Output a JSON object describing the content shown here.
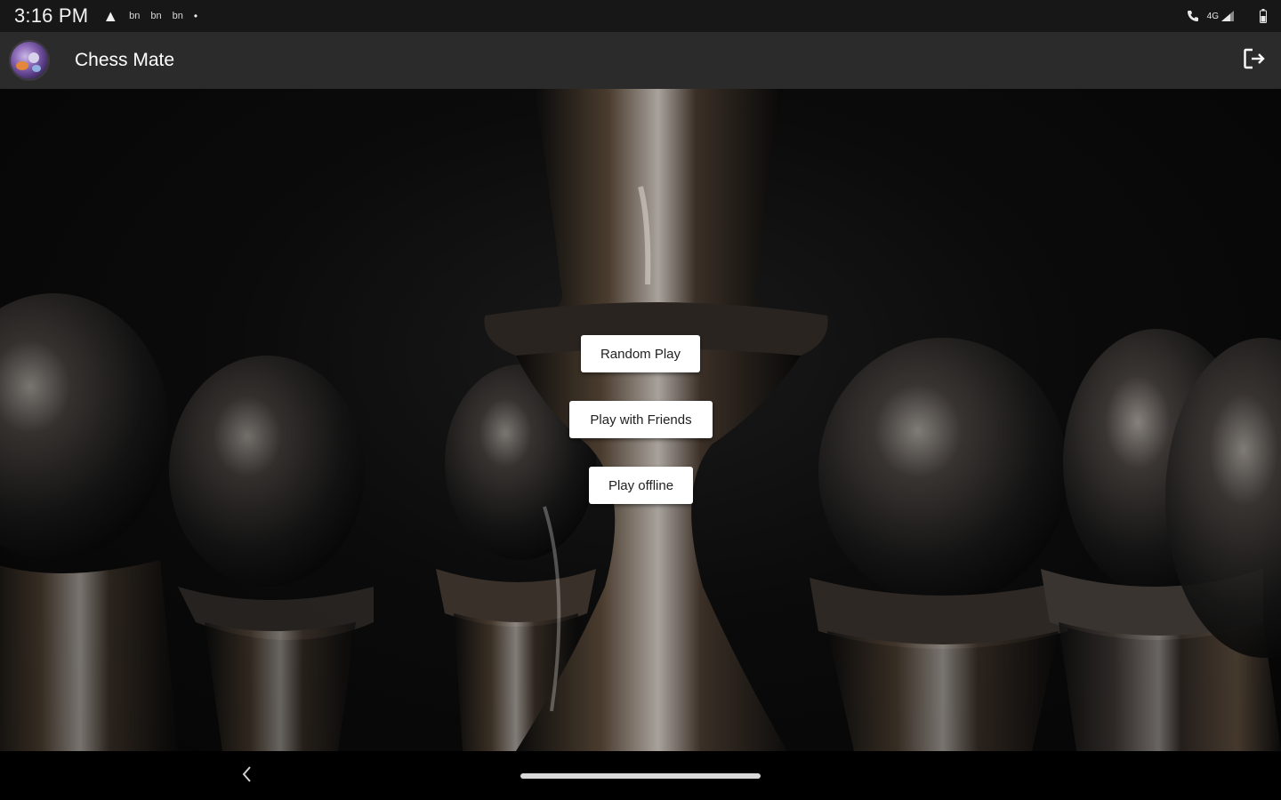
{
  "status_bar": {
    "time": "3:16 PM",
    "notification_icons": [
      "warning-icon",
      "news-icon",
      "news-icon",
      "news-icon",
      "dot-icon"
    ],
    "notif_label": "bn",
    "right_icons": [
      "call-icon",
      "4g-signal-icon",
      "battery-icon"
    ],
    "network": "4G"
  },
  "app_bar": {
    "title": "Chess Mate",
    "avatar": "user-avatar",
    "logout_icon": "logout-icon"
  },
  "menu": {
    "random_play": "Random Play",
    "play_with_friends": "Play with Friends",
    "play_offline": "Play offline"
  },
  "nav_bar": {
    "back_icon": "chevron-left-icon",
    "home_handle": "gesture-handle"
  },
  "colors": {
    "status_bar_bg": "#171717",
    "app_bar_bg": "#2b2b2b",
    "button_bg": "#ffffff",
    "button_text": "#222222",
    "nav_bar_bg": "#000000"
  }
}
